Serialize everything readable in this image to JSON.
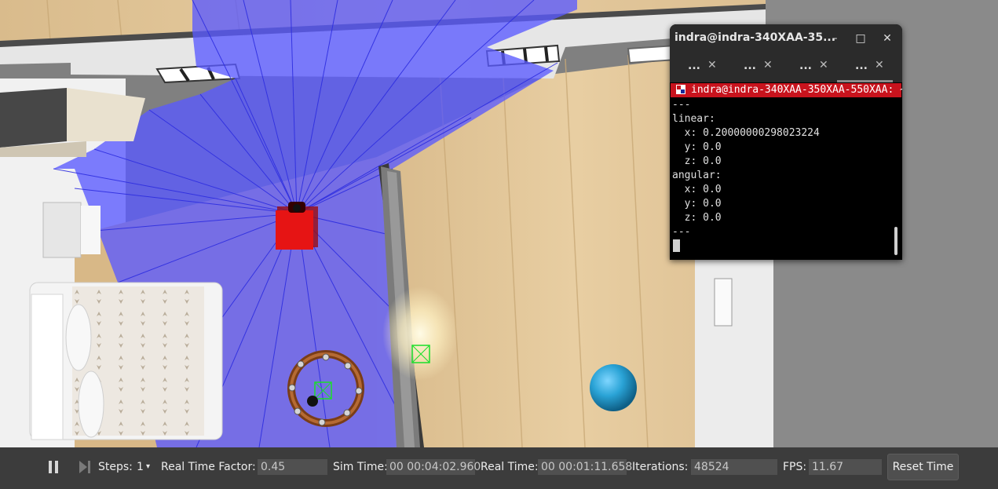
{
  "terminal": {
    "title": "indra@indra-340XAA-35...",
    "tabs": [
      {
        "label": "..."
      },
      {
        "label": "..."
      },
      {
        "label": "..."
      },
      {
        "label": "..."
      }
    ],
    "header_text": "indra@indra-340XAA-350XAA-550XAA: ~",
    "lines": [
      "---",
      "linear:",
      "  x: 0.20000000298023224",
      "  y: 0.0",
      "  z: 0.0",
      "angular:",
      "  x: 0.0",
      "  y: 0.0",
      "  z: 0.0",
      "---"
    ]
  },
  "toolbar": {
    "steps_label": "Steps:",
    "steps_value": "1",
    "rtf_label": "Real Time Factor:",
    "rtf_value": "0.45",
    "sim_time_label": "Sim Time:",
    "sim_time_value": "00 00:04:02.960",
    "real_time_label": "Real Time:",
    "real_time_value": "00 00:01:11.658",
    "iterations_label": "Iterations:",
    "iterations_value": "48524",
    "fps_label": "FPS:",
    "fps_value": "11.67",
    "reset_label": "Reset Time"
  },
  "colors": {
    "laser": "#5a5aff",
    "robot": "#e01010",
    "sphere": "#2aa3d6",
    "terminal_header": "#c8131d",
    "floor": "#e3c79a"
  }
}
